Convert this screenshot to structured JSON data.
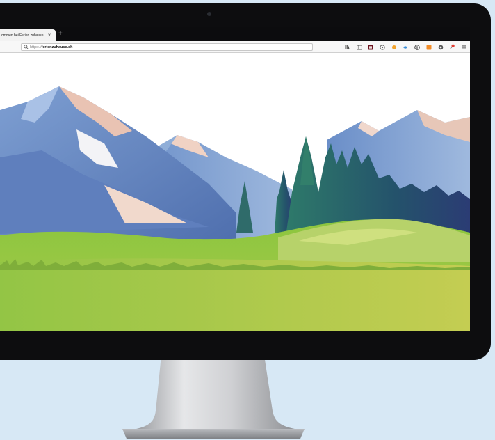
{
  "browser": {
    "tab": {
      "title": "ommen bei Ferien zuhause",
      "close_label": "×"
    },
    "new_tab_label": "+",
    "address": {
      "protocol": "https://",
      "host": "ferienzuhause.ch"
    },
    "toolbar_icons": [
      "library-icon",
      "sidebar-icon",
      "pocket-icon",
      "extension-icon",
      "addon-orange-icon",
      "addon-blue-icon",
      "info-icon",
      "addon-square-icon",
      "record-icon",
      "notification-icon",
      "menu-icon"
    ],
    "colors": {
      "accent_orange": "#f28c28",
      "accent_red": "#e03c31",
      "accent_blue": "#3b8ed8"
    }
  },
  "page": {
    "content": "landscape-illustration",
    "colors": {
      "sky": "#ffffff",
      "mountain_blue": "#6d8fc7",
      "mountain_pink": "#e8b6a4",
      "forest": "#2f6b6a",
      "meadow_green": "#9bcb4e"
    }
  }
}
